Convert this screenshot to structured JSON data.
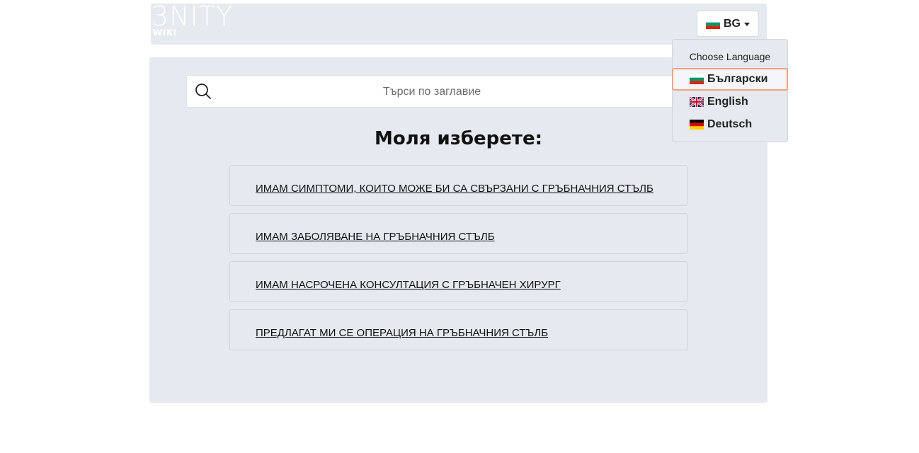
{
  "logo": {
    "main": "3NITY",
    "sub": "WIKI"
  },
  "language_toggle": {
    "code": "BG",
    "flag": "bulgaria-flag-icon"
  },
  "search": {
    "placeholder": "Търси по заглавие",
    "value": "",
    "icon": "search-icon"
  },
  "page_title": "Моля изберете:",
  "options": [
    {
      "label": "ИМАМ СИМПТОМИ, КОИТО МОЖЕ БИ СА СВЪРЗАНИ С ГРЪБНАЧНИЯ СТЪЛБ"
    },
    {
      "label": "ИМАМ ЗАБОЛЯВАНЕ НА ГРЪБНАЧНИЯ СТЪЛБ"
    },
    {
      "label": "ИМАМ НАСРОЧЕНА КОНСУЛТАЦИЯ С ГРЪБНАЧЕН ХИРУРГ"
    },
    {
      "label": "ПРЕДЛАГАТ МИ СЕ ОПЕРАЦИЯ НА ГРЪБНАЧНИЯ СТЪЛБ"
    }
  ],
  "language_menu": {
    "header": "Choose Language",
    "items": [
      {
        "label": "Български",
        "flag": "bulgaria-flag-icon",
        "selected": true
      },
      {
        "label": "English",
        "flag": "uk-flag-icon",
        "selected": false
      },
      {
        "label": "Deutsch",
        "flag": "germany-flag-icon",
        "selected": false
      }
    ]
  },
  "colors": {
    "panel_bg": "#e6e9ef",
    "active_border": "#f0a27f"
  }
}
